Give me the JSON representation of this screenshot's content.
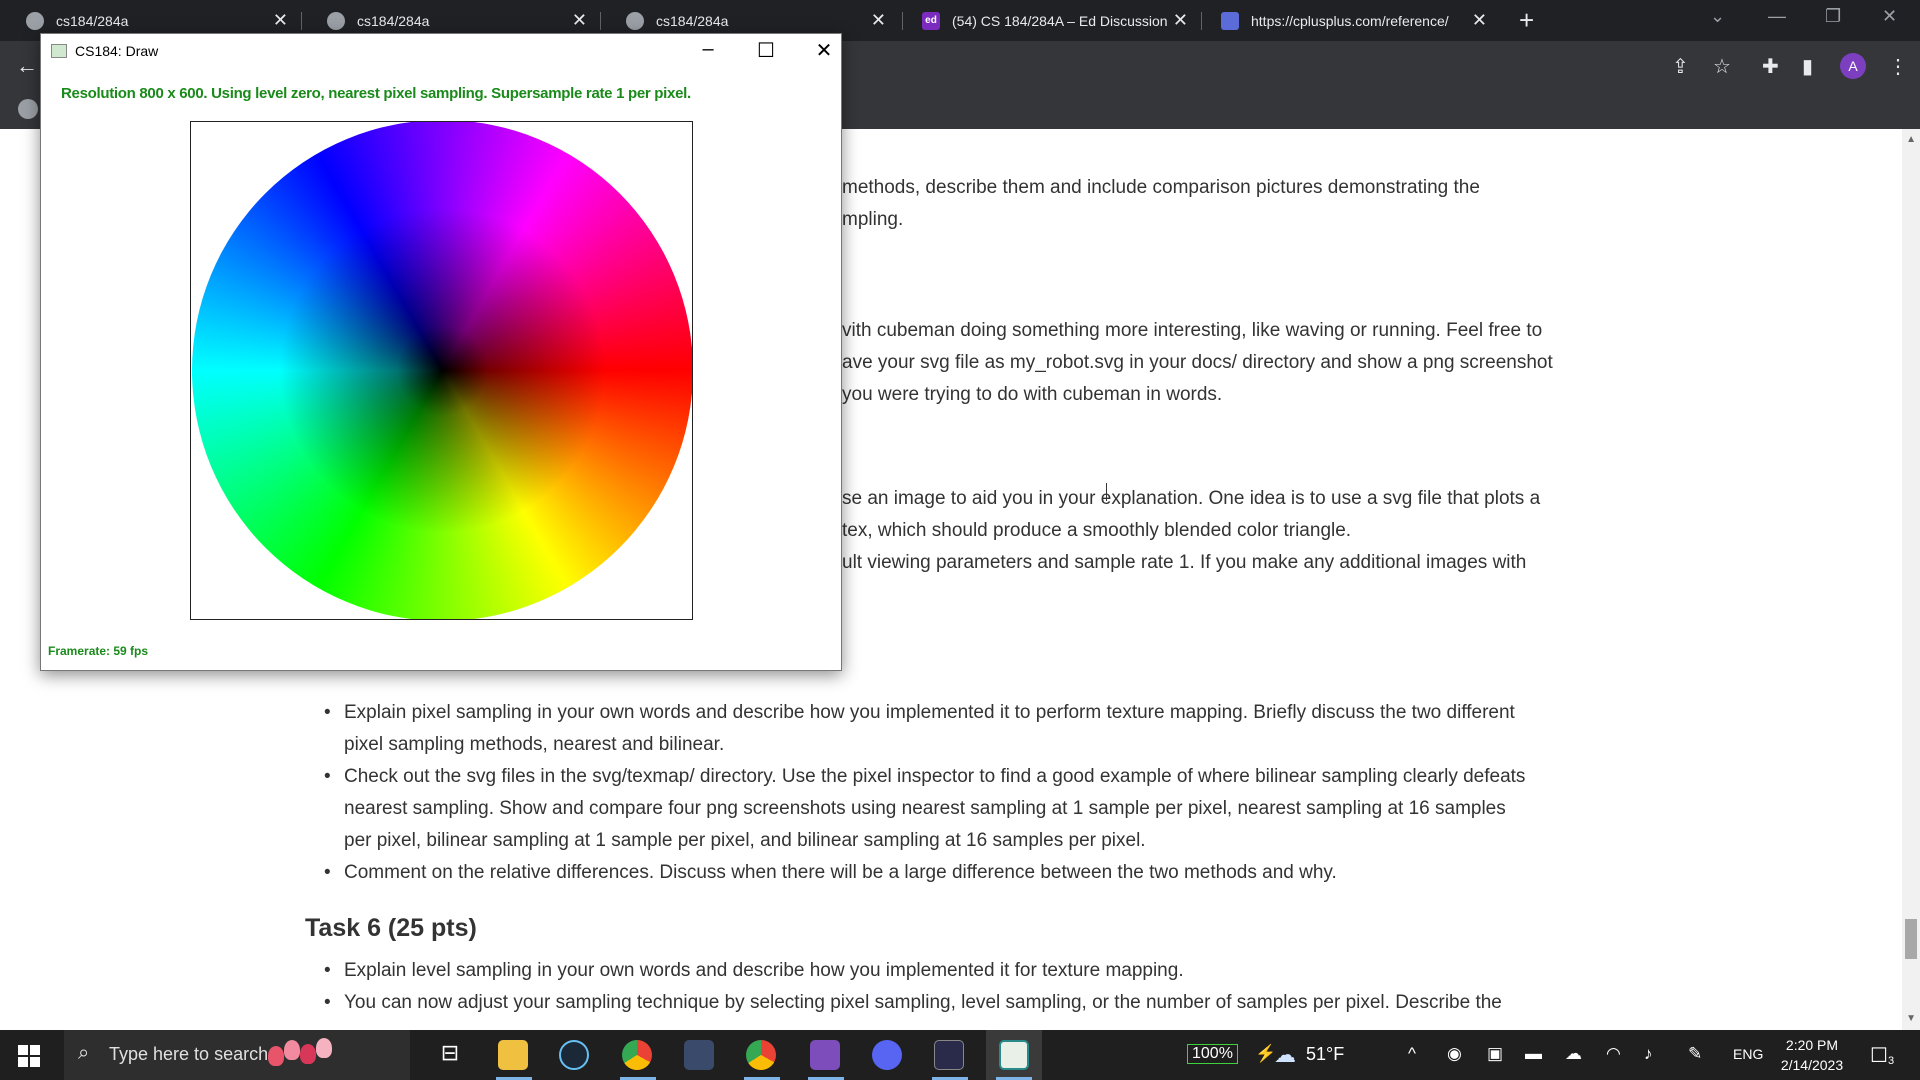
{
  "browser": {
    "tabs": [
      {
        "title": "cs184/284a"
      },
      {
        "title": "cs184/284a"
      },
      {
        "title": "cs184/284a"
      },
      {
        "title": "(54) CS 184/284A – Ed Discussion"
      },
      {
        "title": "https://cplusplus.com/reference/"
      }
    ],
    "ed_favicon_text": "ed",
    "avatar_letter": "A"
  },
  "page": {
    "lines": [
      "methods, describe them and include comparison pictures demonstrating the",
      "mpling.",
      "vith cubeman doing something more interesting, like waving or running. Feel free to",
      "ave your svg file as my_robot.svg in your docs/ directory and show a png screenshot",
      "you were trying to do with cubeman in words.",
      "se an image to aid you in your explanation. One idea is to use a svg file that plots a",
      "tex, which should produce a smoothly blended color triangle.",
      "ult viewing parameters and sample rate 1. If you make any additional images with"
    ],
    "task5_bullets": [
      "Explain pixel sampling in your own words and describe how you implemented it to perform texture mapping. Briefly discuss the two different",
      "pixel sampling methods, nearest and bilinear.",
      "Check out the svg files in the svg/texmap/ directory. Use the pixel inspector to find a good example of where bilinear sampling clearly defeats",
      "nearest sampling. Show and compare four png screenshots using nearest sampling at 1 sample per pixel, nearest sampling at 16 samples",
      "per pixel, bilinear sampling at 1 sample per pixel, and bilinear sampling at 16 samples per pixel.",
      "Comment on the relative differences. Discuss when there will be a large difference between the two methods and why."
    ],
    "task6_heading": "Task 6 (25 pts)",
    "task6_bullets": [
      "Explain level sampling in your own words and describe how you implemented it for texture mapping.",
      "You can now adjust your sampling technique by selecting pixel sampling, level sampling, or the number of samples per pixel. Describe the"
    ]
  },
  "draw_window": {
    "title": "CS184: Draw",
    "status": "Resolution 800 x 600. Using level zero, nearest pixel sampling. Supersample rate 1 per pixel.",
    "framerate": "Framerate: 59 fps",
    "status_color": "#1a8a1a"
  },
  "taskbar": {
    "search_placeholder": "Type here to search",
    "battery": "100%",
    "temperature": "51°F",
    "language": "ENG",
    "time": "2:20 PM",
    "date": "2/14/2023",
    "notifications": "3"
  }
}
